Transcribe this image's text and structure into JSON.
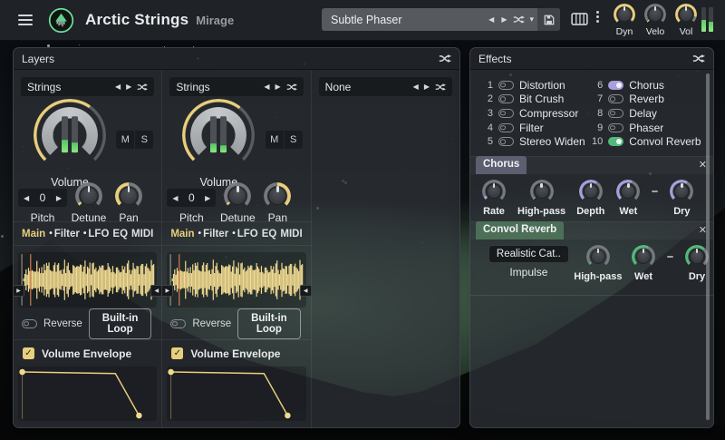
{
  "icons": {
    "prev": "◀",
    "next": "▶",
    "dropdown": "▾",
    "close": "✕",
    "check": "✓",
    "bullet": "•",
    "marker_left": "▶",
    "marker_right": "◀"
  },
  "colors": {
    "yellow_accent": "#e9cf7d",
    "purple_accent": "#a89fdc",
    "green_accent": "#53b97a",
    "knob_track": "#76797d",
    "meter_green": "#8ce87e"
  },
  "titlebar": {
    "app_title": "Arctic Strings",
    "app_subtitle": "Mirage",
    "preset": {
      "value": "Subtle Phaser"
    },
    "macro_knobs": [
      {
        "label": "Dyn",
        "value": 0.97
      },
      {
        "label": "Velo",
        "value": 0.02
      },
      {
        "label": "Vol",
        "value": 0.88
      }
    ],
    "meter": {
      "left": 0.48,
      "right": 0.4
    }
  },
  "layers_panel": {
    "title": "Layers",
    "columns": [
      {
        "name": "Strings",
        "empty": false,
        "volume": {
          "label": "Volume",
          "value": 0.63,
          "meter_l": 0.34,
          "meter_r": 0.28
        },
        "mute": "M",
        "solo": "S",
        "pitch": {
          "label": "Pitch",
          "value": "0"
        },
        "detune": {
          "label": "Detune",
          "value": 0.04
        },
        "pan": {
          "label": "Pan",
          "value": 0.0,
          "bipolar": true
        },
        "tabs": [
          {
            "label": "Main",
            "active": true,
            "dot": false
          },
          {
            "label": "Filter",
            "active": false,
            "dot": true
          },
          {
            "label": "LFO",
            "active": false,
            "dot": true
          },
          {
            "label": "EQ",
            "active": false,
            "dot": false
          },
          {
            "label": "MIDI",
            "active": false,
            "dot": false
          }
        ],
        "reverse_label": "Reverse",
        "loop_button_label": "Built-in Loop",
        "envelope_label": "Volume Envelope",
        "envelope_points": [
          [
            0.03,
            0.1
          ],
          [
            0.7,
            0.13
          ],
          [
            0.87,
            0.9
          ]
        ]
      },
      {
        "name": "Strings",
        "empty": false,
        "volume": {
          "label": "Volume",
          "value": 0.64,
          "meter_l": 0.24,
          "meter_r": 0.2
        },
        "mute": "M",
        "solo": "S",
        "pitch": {
          "label": "Pitch",
          "value": "0"
        },
        "detune": {
          "label": "Detune",
          "value": 0.04
        },
        "pan": {
          "label": "Pan",
          "value": 1.0,
          "bipolar": true
        },
        "tabs": [
          {
            "label": "Main",
            "active": true,
            "dot": false
          },
          {
            "label": "Filter",
            "active": false,
            "dot": true
          },
          {
            "label": "LFO",
            "active": false,
            "dot": true
          },
          {
            "label": "EQ",
            "active": false,
            "dot": false
          },
          {
            "label": "MIDI",
            "active": false,
            "dot": false
          }
        ],
        "reverse_label": "Reverse",
        "loop_button_label": "Built-in Loop",
        "envelope_label": "Volume Envelope",
        "envelope_points": [
          [
            0.03,
            0.1
          ],
          [
            0.7,
            0.13
          ],
          [
            0.87,
            0.9
          ]
        ]
      },
      {
        "name": "None",
        "empty": true
      }
    ]
  },
  "effects_panel": {
    "title": "Effects",
    "slots": [
      {
        "num": "1",
        "name": "Distortion",
        "on": false
      },
      {
        "num": "2",
        "name": "Bit Crush",
        "on": false
      },
      {
        "num": "3",
        "name": "Compressor",
        "on": false
      },
      {
        "num": "4",
        "name": "Filter",
        "on": false
      },
      {
        "num": "5",
        "name": "Stereo Widen",
        "on": false
      },
      {
        "num": "6",
        "name": "Chorus",
        "on": true,
        "color": "#a89fdc"
      },
      {
        "num": "7",
        "name": "Reverb",
        "on": false
      },
      {
        "num": "8",
        "name": "Delay",
        "on": false
      },
      {
        "num": "9",
        "name": "Phaser",
        "on": false
      },
      {
        "num": "10",
        "name": "Convol Reverb",
        "on": true,
        "color": "#53b97a"
      }
    ],
    "sections": [
      {
        "title": "Chorus",
        "tag_bg": "#5e5e71",
        "accent": "#a89fdc",
        "close_icon": "✕",
        "knobs": [
          {
            "label": "Rate",
            "value": 0.06
          },
          {
            "label": "High-pass",
            "value": 0.02
          },
          {
            "label": "Depth",
            "value": 0.62
          },
          {
            "label": "Wet",
            "value": 0.58,
            "dash_after": true
          },
          {
            "label": "Dry",
            "value": 0.62
          }
        ]
      },
      {
        "title": "Convol Reverb",
        "tag_bg": "#4d6f58",
        "accent": "#53b97a",
        "close_icon": "✕",
        "impulse_button_label": "Realistic Cat..",
        "impulse_label": "Impulse",
        "knobs": [
          {
            "label": "High-pass",
            "value": 0.03
          },
          {
            "label": "Wet",
            "value": 0.6,
            "dash_after": true
          },
          {
            "label": "Dry",
            "value": 0.66
          }
        ]
      }
    ]
  }
}
